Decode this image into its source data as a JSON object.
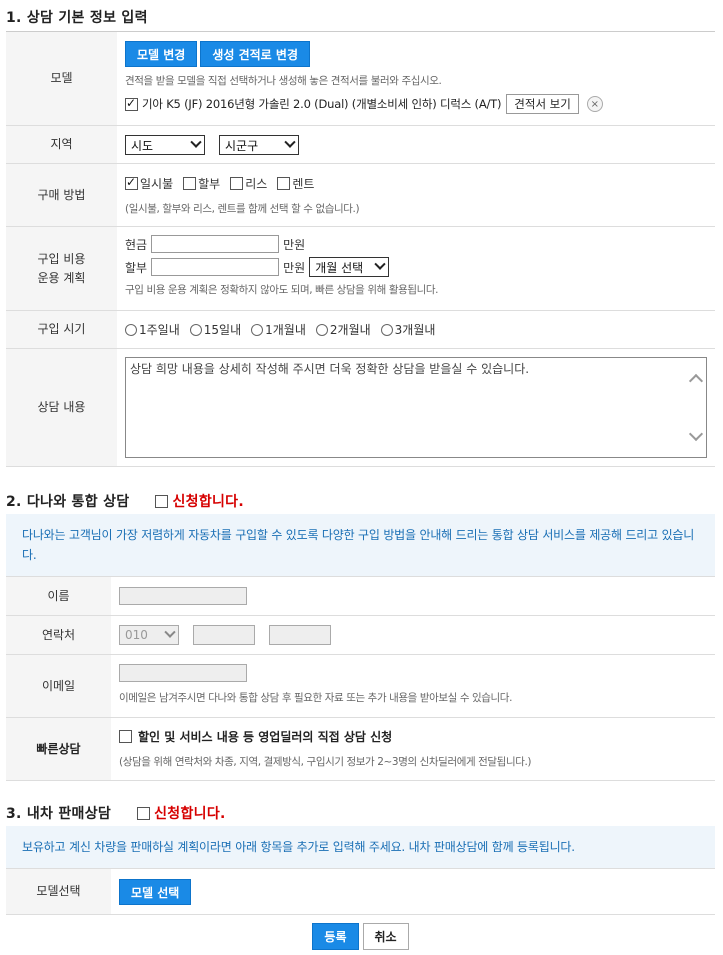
{
  "section1": {
    "title": "1. 상담 기본 정보 입력",
    "model": {
      "label": "모델",
      "btn_change": "모델 변경",
      "btn_quote": "생성 견적로 변경",
      "note": "견적을 받을 모델을 직접 선택하거나 생성해 놓은 견적서를 불러와 주십시오.",
      "selected": "기아 K5 (JF) 2016년형 가솔린 2.0 (Dual) (개별소비세 인하) 디럭스 (A/T)",
      "btn_view": "견적서 보기",
      "remove_icon": "×"
    },
    "region": {
      "label": "지역",
      "sido": "시도",
      "sigungu": "시군구"
    },
    "purchase": {
      "label": "구매 방법",
      "options": [
        "일시불",
        "할부",
        "리스",
        "렌트"
      ],
      "note": "(일시불, 할부와 리스, 렌트를 함께 선택 할 수 없습니다.)"
    },
    "cost": {
      "label_line1": "구입 비용",
      "label_line2": "운용 계획",
      "cash_label": "현금",
      "installment_label": "할부",
      "unit": "만원",
      "months_select": "개월 선택",
      "note": "구입 비용 운용 계획은 정확하지 않아도 되며, 빠른 상담을 위해 활용됩니다."
    },
    "timing": {
      "label": "구입 시기",
      "options": [
        "1주일내",
        "15일내",
        "1개월내",
        "2개월내",
        "3개월내"
      ]
    },
    "content": {
      "label": "상담 내용",
      "placeholder": "상담 희망 내용을 상세히 작성해 주시면 더욱 정확한 상담을 받을실 수 있습니다."
    }
  },
  "section2": {
    "title": "2. 다나와 통합 상담",
    "apply": "신청합니다.",
    "info": "다나와는 고객님이 가장 저렴하게 자동차를 구입할 수 있도록 다양한 구입 방법을 안내해 드리는 통합 상담 서비스를 제공해 드리고 있습니다.",
    "name_label": "이름",
    "phone_label": "연락처",
    "phone_prefix": "010",
    "email_label": "이메일",
    "email_note": "이메일은 남겨주시면 다나와 통합 상담 후 필요한 자료 또는 추가 내용을 받아보실 수 있습니다.",
    "quick_label": "빠른상담",
    "quick_option": "할인 및 서비스 내용 등 영업딜러의 직접 상담 신청",
    "quick_note": "(상담을 위해 연락처와 차종, 지역, 결제방식, 구입시기 정보가 2~3명의 신차딜러에게 전달됩니다.)"
  },
  "section3": {
    "title": "3. 내차 판매상담",
    "apply": "신청합니다.",
    "info": "보유하고 계신 차량을 판매하실 계획이라면 아래 항목을 추가로 입력해 주세요. 내차 판매상담에 함께 등록됩니다.",
    "model_label": "모델선택",
    "model_btn": "모델 선택"
  },
  "footer": {
    "submit": "등록",
    "cancel": "취소"
  }
}
